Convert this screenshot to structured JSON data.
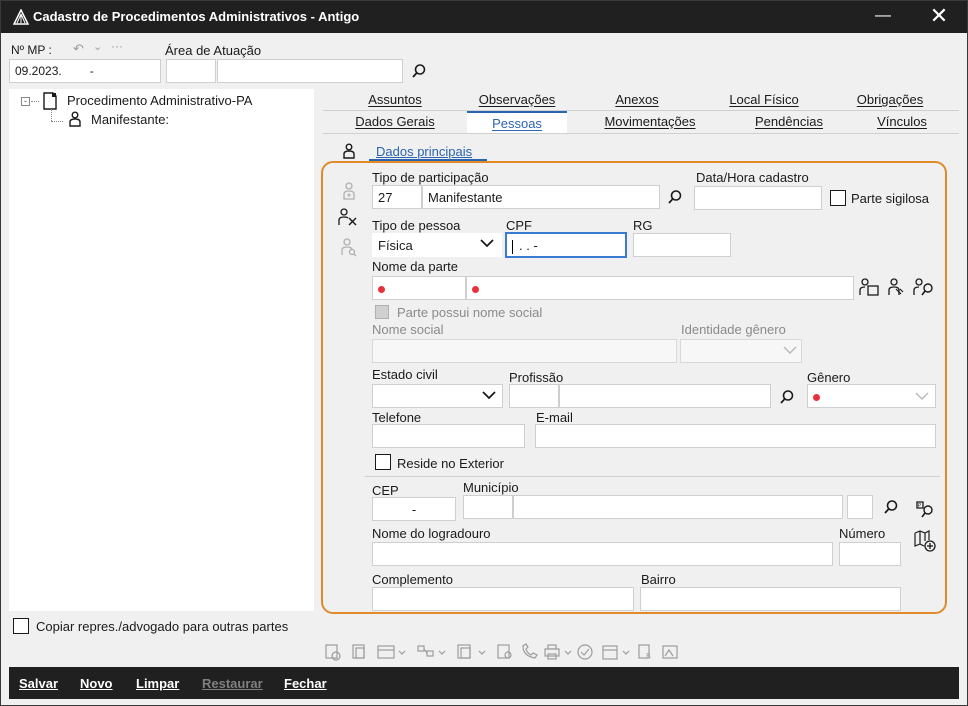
{
  "window": {
    "title": "Cadastro de Procedimentos Administrativos - Antigo"
  },
  "header": {
    "mp_label": "Nº MP :",
    "mp_value": "09.2023.",
    "mp_value2": "-",
    "area_label": "Área de Atuação"
  },
  "tree": {
    "root_label": "Procedimento Administrativo-PA",
    "child_label": "Manifestante:"
  },
  "tabs_row1": [
    "Assuntos",
    "Observações",
    "Anexos",
    "Local Físico",
    "Obrigações"
  ],
  "tabs_row2": [
    "Dados Gerais",
    "Pessoas",
    "Movimentações",
    "Pendências",
    "Vínculos"
  ],
  "subtab": "Dados principais",
  "form": {
    "tipo_participacao_label": "Tipo de participação",
    "tipo_participacao_code": "27",
    "tipo_participacao_value": "Manifestante",
    "data_hora_label": "Data/Hora cadastro",
    "parte_sigilosa_label": "Parte sigilosa",
    "tipo_pessoa_label": "Tipo de pessoa",
    "tipo_pessoa_value": "Física",
    "cpf_label": "CPF",
    "cpf_value": ". . -",
    "rg_label": "RG",
    "nome_parte_label": "Nome da parte",
    "nome_social_check_label": "Parte possui nome social",
    "nome_social_label": "Nome social",
    "identidade_genero_label": "Identidade gênero",
    "estado_civil_label": "Estado civil",
    "profissao_label": "Profissão",
    "genero_label": "Gênero",
    "telefone_label": "Telefone",
    "email_label": "E-mail",
    "reside_exterior_label": "Reside no Exterior",
    "cep_label": "CEP",
    "cep_value": "-",
    "municipio_label": "Município",
    "logradouro_label": "Nome do logradouro",
    "numero_label": "Número",
    "complemento_label": "Complemento",
    "bairro_label": "Bairro"
  },
  "copiar_label": "Copiar repres./advogado para outras partes",
  "footer": {
    "salvar": "Salvar",
    "novo": "Novo",
    "limpar": "Limpar",
    "restaurar": "Restaurar",
    "fechar": "Fechar"
  },
  "colors": {
    "accent": "#2a64b0",
    "highlight_border": "#e08a2a",
    "required_dot": "#e8313a",
    "titlebar": "#202020"
  }
}
